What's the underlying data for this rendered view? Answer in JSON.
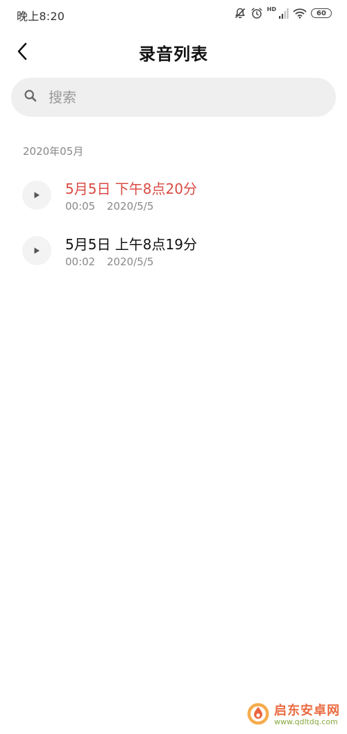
{
  "status_bar": {
    "time": "晚上8:20",
    "icons": [
      "mute-icon",
      "alarm-icon",
      "signal-icon",
      "wifi-icon",
      "battery-icon"
    ],
    "hd_label": "HD",
    "battery_level": "60"
  },
  "header": {
    "title": "录音列表",
    "back_icon": "chevron-left-icon"
  },
  "search": {
    "placeholder": "搜索",
    "value": ""
  },
  "section": {
    "label": "2020年05月"
  },
  "recordings": [
    {
      "title": "5月5日 下午8点20分",
      "duration": "00:05",
      "date": "2020/5/5",
      "active": true,
      "active_color": "#d94a43"
    },
    {
      "title": "5月5日 上午8点19分",
      "duration": "00:02",
      "date": "2020/5/5",
      "active": false
    }
  ],
  "watermark": {
    "name": "启东安卓网",
    "url": "www.qdltdq.com"
  },
  "colors": {
    "accent": "#d94a43",
    "search_bg": "#efefef",
    "secondary_text": "#888888"
  }
}
